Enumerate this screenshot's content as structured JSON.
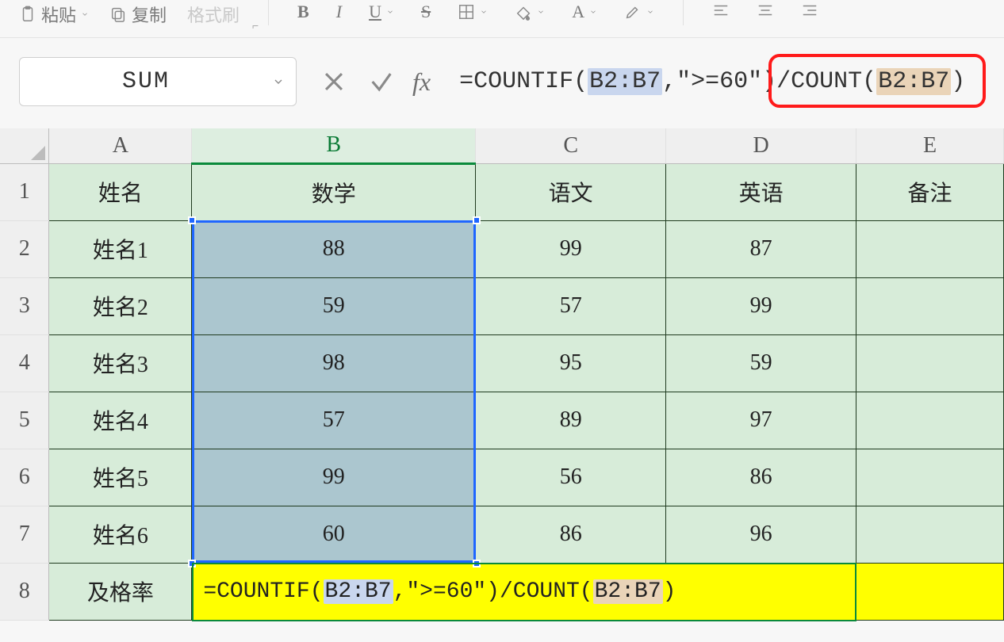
{
  "ribbon": {
    "paste": "粘贴",
    "copy": "复制",
    "format_painter": "格式刷"
  },
  "name_box": {
    "value": "SUM"
  },
  "formula_bar": {
    "fx_label": "fx",
    "formula_prefix": "=COUNTIF(",
    "formula_ref1": "B2:B7",
    "formula_mid": ",\">=60\")/COUNT(",
    "formula_ref2": "B2:B7",
    "formula_suffix": ")"
  },
  "columns": [
    "A",
    "B",
    "C",
    "D",
    "E"
  ],
  "rows": [
    "1",
    "2",
    "3",
    "4",
    "5",
    "6",
    "7",
    "8"
  ],
  "header_row": {
    "A": "姓名",
    "B": "数学",
    "C": "语文",
    "D": "英语",
    "E": "备注"
  },
  "data": [
    {
      "A": "姓名1",
      "B": "88",
      "C": "99",
      "D": "87",
      "E": ""
    },
    {
      "A": "姓名2",
      "B": "59",
      "C": "57",
      "D": "99",
      "E": ""
    },
    {
      "A": "姓名3",
      "B": "98",
      "C": "95",
      "D": "59",
      "E": ""
    },
    {
      "A": "姓名4",
      "B": "57",
      "C": "89",
      "D": "97",
      "E": ""
    },
    {
      "A": "姓名5",
      "B": "99",
      "C": "56",
      "D": "86",
      "E": ""
    },
    {
      "A": "姓名6",
      "B": "60",
      "C": "86",
      "D": "96",
      "E": ""
    }
  ],
  "footer_row": {
    "A": "及格率",
    "B_prefix": "=COUNTIF(",
    "B_ref1": "B2:B7",
    "B_mid": ",\">=60\")/COUNT(",
    "B_ref2": "B2:B7",
    "B_suffix": ")"
  }
}
